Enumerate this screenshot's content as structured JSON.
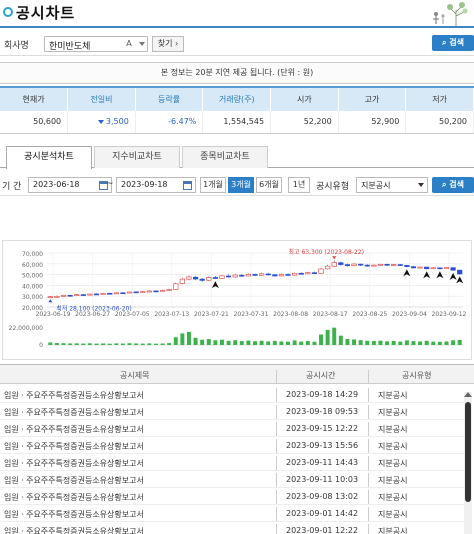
{
  "page": {
    "title": "공시차트"
  },
  "company_row": {
    "label": "회사명",
    "company_value": "한미반도체",
    "a_label": "A",
    "find_label": "찾기",
    "find_arrow": "›",
    "search_label": "검색"
  },
  "notice": "본 정보는 20분 지연 제공 됩니다. (단위 : 원)",
  "quote": {
    "headers": [
      "현재가",
      "전일비",
      "등락률",
      "거래량(주)",
      "시가",
      "고가",
      "저가"
    ],
    "values": [
      "50,600",
      "3,500",
      "-6.47%",
      "1,554,545",
      "52,200",
      "52,900",
      "50,200"
    ]
  },
  "tabs": [
    {
      "label": "공시분석차트",
      "active": true
    },
    {
      "label": "지수비교차트",
      "active": false
    },
    {
      "label": "종목비교차트",
      "active": false
    }
  ],
  "period_row": {
    "label": "기 간",
    "start_date": "2023-06-18",
    "tilde": "~",
    "end_date": "2023-09-18",
    "period_buttons": [
      {
        "label": "1개월",
        "active": false
      },
      {
        "label": "3개월",
        "active": true
      },
      {
        "label": "6개월",
        "active": false
      },
      {
        "label": "1년",
        "active": false
      }
    ],
    "type_label": "공시유형",
    "type_value": "지분공시",
    "search_label": "검색"
  },
  "chart_data": {
    "type": "candlestick",
    "ylim": [
      20000,
      70000
    ],
    "y_ticks": [
      "70,000",
      "60,000",
      "50,000",
      "40,000",
      "30,000",
      "20,000"
    ],
    "y_tick_values": [
      70000,
      60000,
      50000,
      40000,
      30000,
      20000
    ],
    "x_ticks": [
      "2023-06-19",
      "2023-06-27",
      "2023-07-05",
      "2023-07-13",
      "2023-07-21",
      "2023-07-31",
      "2023-08-08",
      "2023-08-17",
      "2023-08-25",
      "2023-09-04",
      "2023-09-12"
    ],
    "high_label": "최고 63,300 (2023-08-22)",
    "low_label": "최저 28,100 (2023-06-20)",
    "volume_max_label": "22,000,000",
    "candles": [
      {
        "o": 28800,
        "c": 29500,
        "h": 30200,
        "l": 28100
      },
      {
        "o": 29400,
        "c": 29900,
        "h": 30600,
        "l": 29000
      },
      {
        "o": 30100,
        "c": 30800,
        "h": 31400,
        "l": 29700
      },
      {
        "o": 30800,
        "c": 30300,
        "h": 31200,
        "l": 29900
      },
      {
        "o": 30600,
        "c": 31400,
        "h": 31900,
        "l": 30300
      },
      {
        "o": 31500,
        "c": 30900,
        "h": 32000,
        "l": 30500
      },
      {
        "o": 31000,
        "c": 32000,
        "h": 32500,
        "l": 30800
      },
      {
        "o": 32100,
        "c": 31700,
        "h": 32700,
        "l": 31300
      },
      {
        "o": 31800,
        "c": 32600,
        "h": 33100,
        "l": 31500
      },
      {
        "o": 32700,
        "c": 32200,
        "h": 33200,
        "l": 31800
      },
      {
        "o": 32300,
        "c": 33100,
        "h": 33700,
        "l": 32000
      },
      {
        "o": 33200,
        "c": 32800,
        "h": 33800,
        "l": 32300
      },
      {
        "o": 32900,
        "c": 33900,
        "h": 34400,
        "l": 32600
      },
      {
        "o": 34000,
        "c": 33500,
        "h": 34600,
        "l": 33000
      },
      {
        "o": 33600,
        "c": 34200,
        "h": 34800,
        "l": 33200
      },
      {
        "o": 34200,
        "c": 34800,
        "h": 35600,
        "l": 33800
      },
      {
        "o": 34900,
        "c": 34500,
        "h": 35400,
        "l": 34000
      },
      {
        "o": 34600,
        "c": 35500,
        "h": 36200,
        "l": 34300
      },
      {
        "o": 35500,
        "c": 36200,
        "h": 37000,
        "l": 35000
      },
      {
        "o": 36300,
        "c": 41500,
        "h": 42500,
        "l": 36000
      },
      {
        "o": 41800,
        "c": 45800,
        "h": 47200,
        "l": 41000
      },
      {
        "o": 45800,
        "c": 47800,
        "h": 49300,
        "l": 44500
      },
      {
        "o": 47600,
        "c": 45900,
        "h": 48500,
        "l": 44800
      },
      {
        "o": 45800,
        "c": 44600,
        "h": 47000,
        "l": 43500
      },
      {
        "o": 44800,
        "c": 47300,
        "h": 48200,
        "l": 44000
      },
      {
        "o": 47400,
        "c": 46400,
        "h": 48800,
        "l": 45800
      },
      {
        "o": 46500,
        "c": 48800,
        "h": 49600,
        "l": 45800
      },
      {
        "o": 48700,
        "c": 47800,
        "h": 50300,
        "l": 47200
      },
      {
        "o": 47800,
        "c": 49600,
        "h": 50700,
        "l": 47000
      },
      {
        "o": 49500,
        "c": 48500,
        "h": 50400,
        "l": 47800
      },
      {
        "o": 48700,
        "c": 50300,
        "h": 51200,
        "l": 48300
      },
      {
        "o": 50200,
        "c": 49300,
        "h": 51000,
        "l": 48700
      },
      {
        "o": 49400,
        "c": 50700,
        "h": 51800,
        "l": 48900
      },
      {
        "o": 50600,
        "c": 49800,
        "h": 51600,
        "l": 49200
      },
      {
        "o": 49900,
        "c": 48700,
        "h": 50600,
        "l": 48000
      },
      {
        "o": 48800,
        "c": 50100,
        "h": 50900,
        "l": 48300
      },
      {
        "o": 50200,
        "c": 49400,
        "h": 51100,
        "l": 48800
      },
      {
        "o": 49500,
        "c": 51200,
        "h": 52000,
        "l": 49000
      },
      {
        "o": 51200,
        "c": 50600,
        "h": 52200,
        "l": 50000
      },
      {
        "o": 50700,
        "c": 51800,
        "h": 52600,
        "l": 50300
      },
      {
        "o": 51800,
        "c": 51100,
        "h": 52700,
        "l": 50500
      },
      {
        "o": 51200,
        "c": 55200,
        "h": 56400,
        "l": 50900
      },
      {
        "o": 55300,
        "c": 57800,
        "h": 59200,
        "l": 54600
      },
      {
        "o": 57800,
        "c": 61200,
        "h": 63300,
        "l": 57000
      },
      {
        "o": 61000,
        "c": 59300,
        "h": 62100,
        "l": 58200
      },
      {
        "o": 59300,
        "c": 58300,
        "h": 60400,
        "l": 57400
      },
      {
        "o": 58400,
        "c": 59800,
        "h": 60600,
        "l": 57800
      },
      {
        "o": 59700,
        "c": 58700,
        "h": 60200,
        "l": 57900
      },
      {
        "o": 58800,
        "c": 57900,
        "h": 59600,
        "l": 57100
      },
      {
        "o": 57900,
        "c": 58800,
        "h": 59400,
        "l": 57300
      },
      {
        "o": 58900,
        "c": 59500,
        "h": 60100,
        "l": 58300
      },
      {
        "o": 59500,
        "c": 58700,
        "h": 60200,
        "l": 58100
      },
      {
        "o": 58700,
        "c": 59300,
        "h": 59900,
        "l": 58200
      },
      {
        "o": 59300,
        "c": 58500,
        "h": 59800,
        "l": 57900
      },
      {
        "o": 58500,
        "c": 57300,
        "h": 58900,
        "l": 56800
      },
      {
        "o": 57400,
        "c": 56200,
        "h": 57900,
        "l": 55600
      },
      {
        "o": 56300,
        "c": 57000,
        "h": 57600,
        "l": 55800
      },
      {
        "o": 57000,
        "c": 55400,
        "h": 57300,
        "l": 54900
      },
      {
        "o": 55500,
        "c": 56300,
        "h": 56900,
        "l": 55000
      },
      {
        "o": 56300,
        "c": 55600,
        "h": 56800,
        "l": 55000
      },
      {
        "o": 55700,
        "c": 56400,
        "h": 56900,
        "l": 55200
      },
      {
        "o": 56400,
        "c": 54100,
        "h": 56800,
        "l": 53500
      },
      {
        "o": 54100,
        "c": 50600,
        "h": 54500,
        "l": 50200
      }
    ],
    "volumes": [
      3.1,
      2.4,
      2.2,
      1.9,
      2.0,
      1.8,
      2.1,
      1.7,
      1.9,
      1.6,
      2.0,
      1.8,
      2.2,
      1.9,
      1.7,
      2.0,
      1.6,
      1.8,
      2.3,
      9.5,
      14.2,
      16.0,
      8.8,
      6.4,
      7.2,
      5.8,
      6.5,
      5.1,
      5.9,
      4.8,
      5.4,
      4.6,
      5.2,
      4.4,
      5.0,
      4.3,
      4.1,
      5.6,
      4.2,
      4.8,
      4.0,
      12.8,
      18.5,
      21.2,
      11.4,
      7.3,
      6.8,
      5.9,
      5.2,
      4.8,
      5.3,
      4.5,
      4.9,
      4.2,
      5.6,
      4.7,
      4.3,
      5.1,
      4.1,
      3.9,
      4.4,
      5.8,
      6.2
    ],
    "event_markers": [
      25,
      54,
      57,
      59,
      61,
      62
    ]
  },
  "disclosures": {
    "headers": [
      "공시제목",
      "공시시간",
      "공시유형"
    ],
    "rows": [
      {
        "title": "임원ㆍ주요주주특정증권등소유상황보고서",
        "time": "2023-09-18 14:29",
        "type": "지분공시"
      },
      {
        "title": "임원ㆍ주요주주특정증권등소유상황보고서",
        "time": "2023-09-18 09:53",
        "type": "지분공시"
      },
      {
        "title": "임원ㆍ주요주주특정증권등소유상황보고서",
        "time": "2023-09-15 12:22",
        "type": "지분공시"
      },
      {
        "title": "임원ㆍ주요주주특정증권등소유상황보고서",
        "time": "2023-09-13 15:56",
        "type": "지분공시"
      },
      {
        "title": "임원ㆍ주요주주특정증권등소유상황보고서",
        "time": "2023-09-11 14:43",
        "type": "지분공시"
      },
      {
        "title": "임원ㆍ주요주주특정증권등소유상황보고서",
        "time": "2023-09-11 10:03",
        "type": "지분공시"
      },
      {
        "title": "임원ㆍ주요주주특정증권등소유상황보고서",
        "time": "2023-09-08 13:02",
        "type": "지분공시"
      },
      {
        "title": "임원ㆍ주요주주특정증권등소유상황보고서",
        "time": "2023-09-01 14:42",
        "type": "지분공시"
      },
      {
        "title": "임원ㆍ주요주주특정증권등소유상황보고서",
        "time": "2023-09-01 12:22",
        "type": "지분공시"
      }
    ]
  }
}
